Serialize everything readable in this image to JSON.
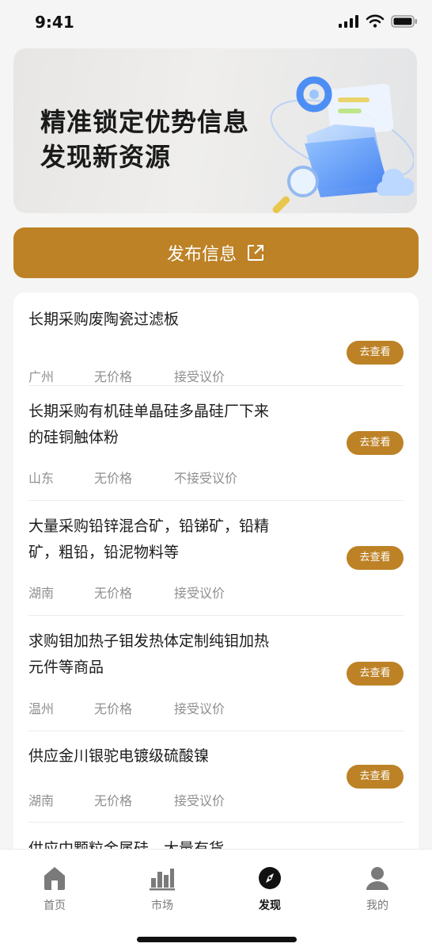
{
  "status_bar": {
    "time": "9:41"
  },
  "banner": {
    "line1": "精准锁定优势信息",
    "line2": "发现新资源"
  },
  "publish_button": {
    "label": "发布信息"
  },
  "listings": [
    {
      "title": "长期采购废陶瓷过滤板",
      "region": "广州",
      "price": "无价格",
      "negotiable": "接受议价",
      "action": "去查看"
    },
    {
      "title": "长期采购有机硅单晶硅多晶硅厂下来的硅铜触体粉",
      "region": "山东",
      "price": "无价格",
      "negotiable": "不接受议价",
      "action": "去查看"
    },
    {
      "title": "大量采购铅锌混合矿，铅锑矿，铅精矿，粗铅，铅泥物料等",
      "region": "湖南",
      "price": "无价格",
      "negotiable": "接受议价",
      "action": "去查看"
    },
    {
      "title": "求购钼加热子钼发热体定制纯钼加热元件等商品",
      "region": "温州",
      "price": "无价格",
      "negotiable": "接受议价",
      "action": "去查看"
    },
    {
      "title": "供应金川银驼电镀级硫酸镍",
      "region": "湖南",
      "price": "无价格",
      "negotiable": "接受议价",
      "action": "去查看"
    },
    {
      "title": "供应中颗粒金属硅，大量有货"
    }
  ],
  "tab_bar": {
    "tabs": [
      {
        "label": "首页",
        "icon": "home-icon"
      },
      {
        "label": "市场",
        "icon": "bar-chart-icon"
      },
      {
        "label": "发现",
        "icon": "compass-icon",
        "active": true
      },
      {
        "label": "我的",
        "icon": "user-icon"
      }
    ]
  },
  "colors": {
    "accent": "#bd8226",
    "background": "#f5f5f5"
  }
}
